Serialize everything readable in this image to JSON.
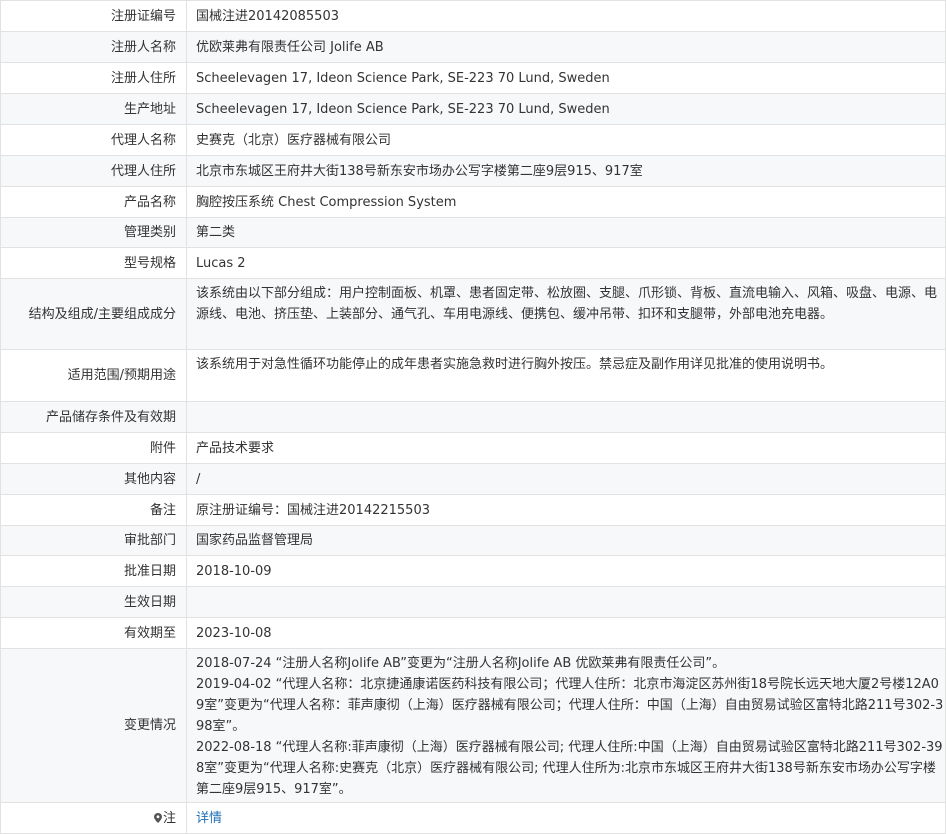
{
  "rows": [
    {
      "label": "注册证编号",
      "value": "国械注进20142085503"
    },
    {
      "label": "注册人名称",
      "value": "优欧莱弗有限责任公司 Jolife AB"
    },
    {
      "label": "注册人住所",
      "value": "Scheelevagen 17, Ideon Science Park, SE-223 70 Lund, Sweden"
    },
    {
      "label": "生产地址",
      "value": "Scheelevagen 17, Ideon Science Park, SE-223 70 Lund, Sweden"
    },
    {
      "label": "代理人名称",
      "value": "史赛克（北京）医疗器械有限公司"
    },
    {
      "label": "代理人住所",
      "value": "北京市东城区王府井大街138号新东安市场办公写字楼第二座9层915、917室"
    },
    {
      "label": "产品名称",
      "value": "胸腔按压系统 Chest Compression System"
    },
    {
      "label": "管理类别",
      "value": "第二类"
    },
    {
      "label": "型号规格",
      "value": "Lucas 2"
    },
    {
      "label": "结构及组成/主要组成成分",
      "value": "该系统由以下部分组成：用户控制面板、机罩、患者固定带、松放圈、支腿、爪形锁、背板、直流电输入、风箱、吸盘、电源、电源线、电池、挤压垫、上装部分、通气孔、车用电源线、便携包、缓冲吊带、扣环和支腿带，外部电池充电器。"
    },
    {
      "label": "适用范围/预期用途",
      "value": "该系统用于对急性循环功能停止的成年患者实施急救时进行胸外按压。禁忌症及副作用详见批准的使用说明书。"
    },
    {
      "label": "产品储存条件及有效期",
      "value": ""
    },
    {
      "label": "附件",
      "value": "产品技术要求"
    },
    {
      "label": "其他内容",
      "value": "/"
    },
    {
      "label": "备注",
      "value": "原注册证编号：国械注进20142215503"
    },
    {
      "label": "审批部门",
      "value": "国家药品监督管理局"
    },
    {
      "label": "批准日期",
      "value": "2018-10-09"
    },
    {
      "label": "生效日期",
      "value": ""
    },
    {
      "label": "有效期至",
      "value": "2023-10-08"
    }
  ],
  "changes": {
    "label": "变更情况",
    "entries": [
      "2018-07-24 “注册人名称Jolife AB”变更为“注册人名称Jolife AB 优欧莱弗有限责任公司”。",
      "2019-04-02 “代理人名称：北京捷通康诺医药科技有限公司；代理人住所：北京市海淀区苏州街18号院长远天地大厦2号楼12A09室”变更为“代理人名称：菲声康彻（上海）医疗器械有限公司；代理人住所：中国（上海）自由贸易试验区富特北路211号302-398室”。",
      "2022-08-18 “代理人名称:菲声康彻（上海）医疗器械有限公司; 代理人住所:中国（上海）自由贸易试验区富特北路211号302-398室”变更为“代理人名称:史赛克（北京）医疗器械有限公司; 代理人住所为:北京市东城区王府井大街138号新东安市场办公写字楼第二座9层915、917室”。"
    ]
  },
  "note": {
    "label": "注",
    "link": "详情",
    "icon": "map-pin-icon"
  }
}
